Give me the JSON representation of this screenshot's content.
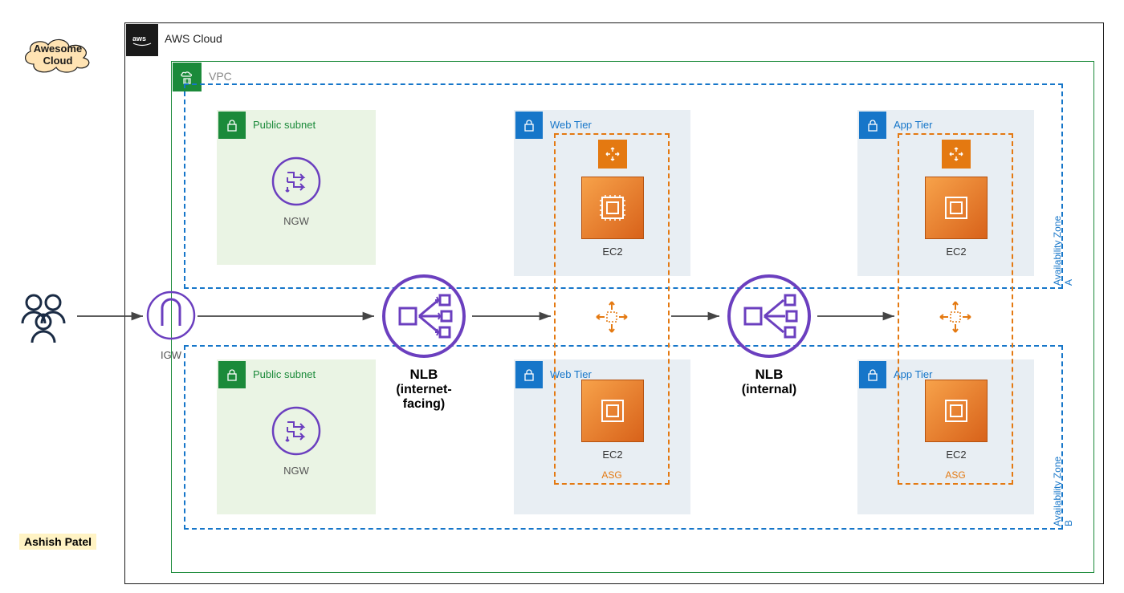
{
  "brand": {
    "name": "Awesome Cloud"
  },
  "author": "Ashish Patel",
  "cloud": {
    "label": "AWS Cloud"
  },
  "vpc": {
    "label": "VPC"
  },
  "subnets": {
    "pub_a": "Public subnet",
    "pub_b": "Public subnet",
    "web_a": "Web Tier",
    "web_b": "Web Tier",
    "app_a": "App Tier",
    "app_b": "App Tier"
  },
  "zones": {
    "a": "Availability Zone A",
    "b": "Availability Zone B"
  },
  "igw": "IGW",
  "ngw": {
    "a": "NGW",
    "b": "NGW"
  },
  "nlb": {
    "external_name": "NLB",
    "external_sub": "(internet-facing)",
    "internal_name": "NLB",
    "internal_sub": "(internal)"
  },
  "ec2": "EC2",
  "asg": "ASG"
}
